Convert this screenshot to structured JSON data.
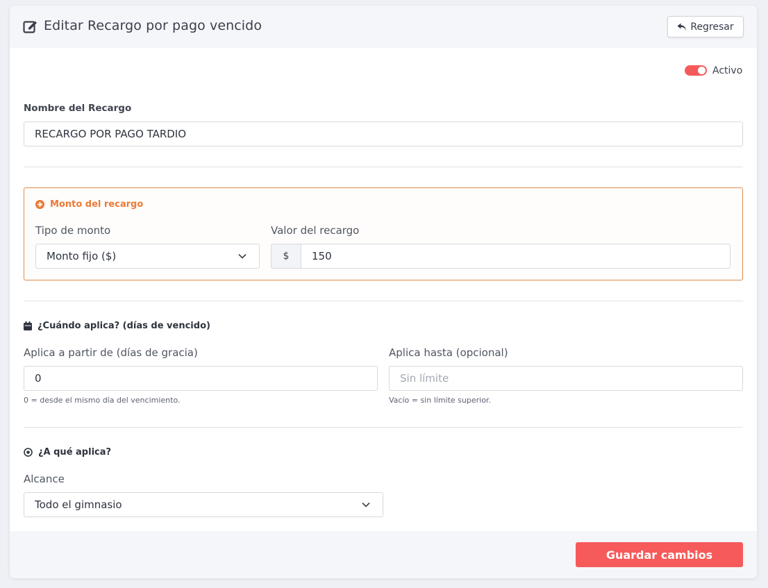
{
  "header": {
    "title": "Editar Recargo por pago vencido",
    "icon": "edit-icon",
    "back_label": "Regresar"
  },
  "status": {
    "label": "Activo",
    "active": true,
    "accent": "#f55a5a"
  },
  "nombre": {
    "label": "Nombre del Recargo",
    "value": "RECARGO POR PAGO TARDIO"
  },
  "monto": {
    "title": "Monto del recargo",
    "accent": "#ea7a35",
    "tipo_label": "Tipo de monto",
    "tipo_value": "Monto fijo ($)",
    "valor_label": "Valor del recargo",
    "valor_prefix": "$",
    "valor_value": "150"
  },
  "cuando": {
    "title": "¿Cuándo aplica? (días de vencido)",
    "desde_label": "Aplica a partir de (días de gracia)",
    "desde_value": "0",
    "desde_help": "0 = desde el mismo día del vencimiento.",
    "hasta_label": "Aplica hasta (opcional)",
    "hasta_placeholder": "Sin límite",
    "hasta_help": "Vacío = sin límite superior."
  },
  "aplica": {
    "title": "¿A qué aplica?",
    "alcance_label": "Alcance",
    "alcance_value": "Todo el gimnasio"
  },
  "footer": {
    "save_label": "Guardar cambios",
    "save_color": "#f75a5a"
  }
}
